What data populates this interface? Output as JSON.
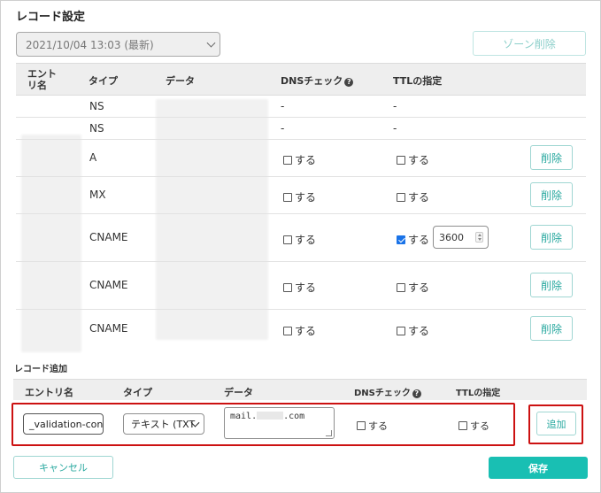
{
  "title": "レコード設定",
  "version_select": {
    "value": "2021/10/04 13:03 (最新)"
  },
  "zone_delete_label": "ゾーン削除",
  "table": {
    "headers": {
      "entry": "エント\nリ名",
      "type": "タイプ",
      "data": "データ",
      "dns": "DNSチェック",
      "ttl": "TTLの指定"
    },
    "rows": [
      {
        "type": "NS",
        "dns": "-",
        "ttl": "-"
      },
      {
        "type": "NS",
        "dns": "-",
        "ttl": "-"
      },
      {
        "type": "A",
        "dns_label": "する",
        "dns_checked": false,
        "ttl_label": "する",
        "ttl_checked": false,
        "delete": "削除"
      },
      {
        "type": "MX",
        "dns_label": "する",
        "dns_checked": false,
        "ttl_label": "する",
        "ttl_checked": false,
        "delete": "削除"
      },
      {
        "type": "CNAME",
        "dns_label": "する",
        "dns_checked": false,
        "ttl_label": "する",
        "ttl_checked": true,
        "ttl_value": "3600",
        "delete": "削除"
      },
      {
        "type": "CNAME",
        "dns_label": "する",
        "dns_checked": false,
        "ttl_label": "する",
        "ttl_checked": false,
        "delete": "削除"
      },
      {
        "type": "CNAME",
        "dns_label": "する",
        "dns_checked": false,
        "ttl_label": "する",
        "ttl_checked": false,
        "delete": "削除"
      }
    ]
  },
  "add_section": {
    "title": "レコード追加",
    "headers": {
      "entry": "エントリ名",
      "type": "タイプ",
      "data": "データ",
      "dns": "DNSチェック",
      "ttl": "TTLの指定"
    },
    "entry_value": "_validation-contac",
    "type_value": "テキスト (TXT",
    "data_value_prefix": "mail.",
    "data_value_suffix": ".com",
    "dns_label": "する",
    "ttl_label": "する",
    "add_label": "追加"
  },
  "footer": {
    "cancel_label": "キャンセル",
    "save_label": "保存"
  },
  "colors": {
    "accent": "#19bfb3",
    "highlight": "#cc1111",
    "checked": "#1a73e8"
  },
  "icons": {
    "help": "help-circle-icon",
    "dropdown": "chevron-down-icon",
    "spinner": "spinner-arrows-icon"
  }
}
